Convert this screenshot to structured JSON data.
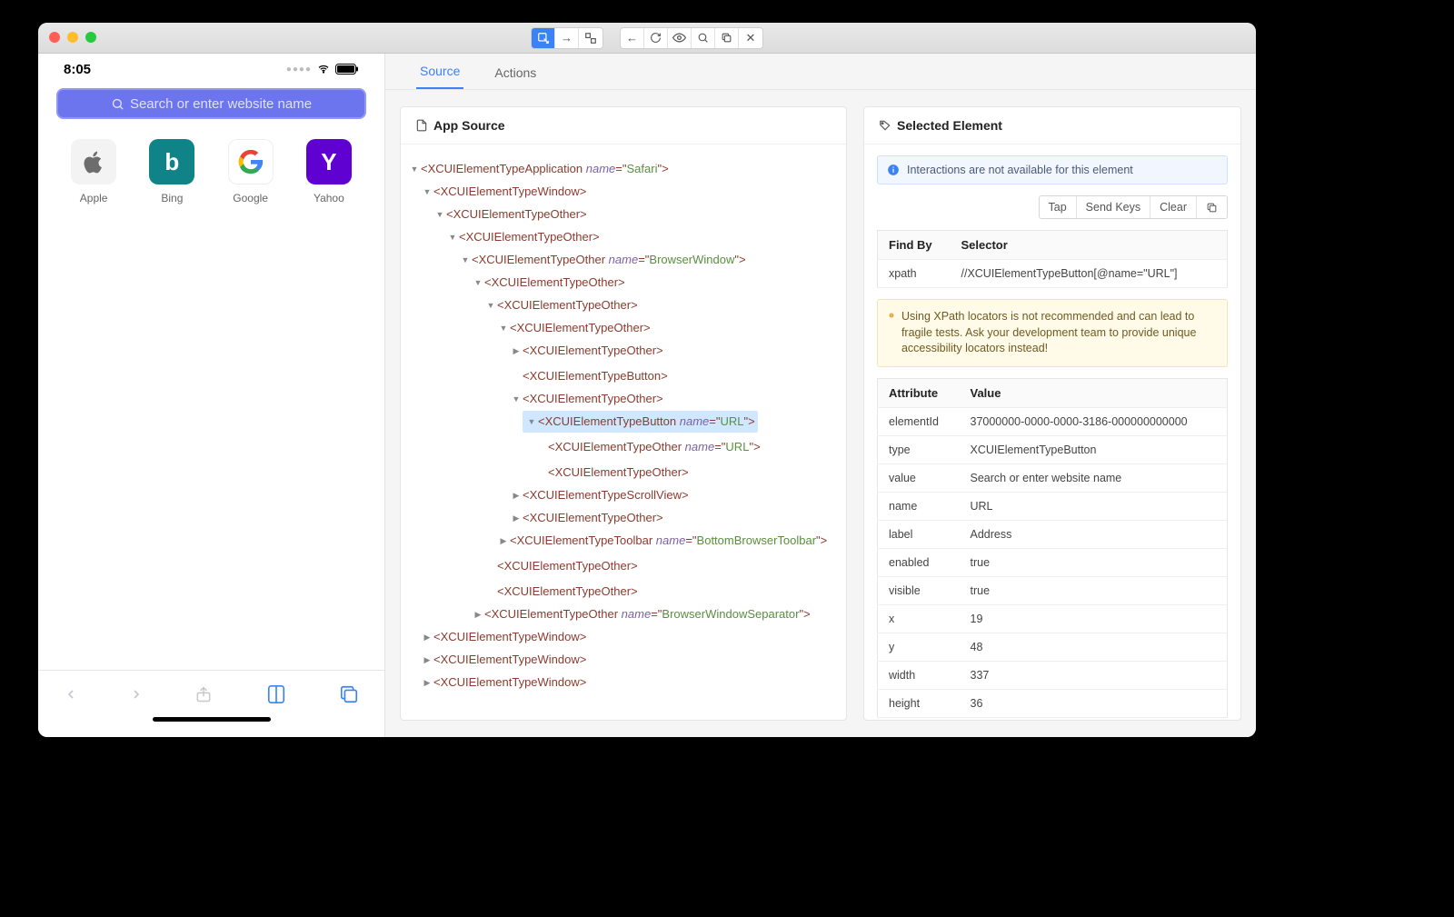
{
  "toolbar": {
    "group1": [
      "select",
      "swipe",
      "tap-coord"
    ],
    "group2": [
      "back",
      "refresh",
      "eye",
      "search",
      "copy",
      "close"
    ]
  },
  "tabs": {
    "source": "Source",
    "actions": "Actions"
  },
  "phone": {
    "time": "8:05",
    "search_placeholder": "Search or enter website name",
    "favorites": [
      {
        "label": "Apple"
      },
      {
        "label": "Bing"
      },
      {
        "label": "Google"
      },
      {
        "label": "Yahoo"
      }
    ]
  },
  "app_source": {
    "title": "App Source"
  },
  "tree": {
    "tag": "XCUIElementTypeApplication",
    "attrs": {
      "name": "Safari"
    },
    "open": true,
    "children": [
      {
        "tag": "XCUIElementTypeWindow",
        "open": true,
        "children": [
          {
            "tag": "XCUIElementTypeOther",
            "open": true,
            "children": [
              {
                "tag": "XCUIElementTypeOther",
                "open": true,
                "children": [
                  {
                    "tag": "XCUIElementTypeOther",
                    "attrs": {
                      "name": "BrowserWindow"
                    },
                    "open": true,
                    "children": [
                      {
                        "tag": "XCUIElementTypeOther",
                        "open": true,
                        "children": [
                          {
                            "tag": "XCUIElementTypeOther",
                            "open": true,
                            "children": [
                              {
                                "tag": "XCUIElementTypeOther",
                                "open": true,
                                "children": [
                                  {
                                    "tag": "XCUIElementTypeOther",
                                    "collapsed": true
                                  },
                                  {
                                    "tag": "XCUIElementTypeButton",
                                    "leaf": true
                                  },
                                  {
                                    "tag": "XCUIElementTypeOther",
                                    "open": true,
                                    "children": [
                                      {
                                        "tag": "XCUIElementTypeButton",
                                        "attrs": {
                                          "name": "URL"
                                        },
                                        "open": true,
                                        "selected": true,
                                        "children": [
                                          {
                                            "tag": "XCUIElementTypeOther",
                                            "attrs": {
                                              "name": "URL"
                                            },
                                            "leaf": true
                                          },
                                          {
                                            "tag": "XCUIElementTypeOther",
                                            "leaf": true
                                          }
                                        ]
                                      }
                                    ]
                                  },
                                  {
                                    "tag": "XCUIElementTypeScrollView",
                                    "collapsed": true
                                  },
                                  {
                                    "tag": "XCUIElementTypeOther",
                                    "collapsed": true
                                  }
                                ]
                              },
                              {
                                "tag": "XCUIElementTypeToolbar",
                                "attrs": {
                                  "name": "BottomBrowserToolbar"
                                },
                                "collapsed": true
                              }
                            ]
                          },
                          {
                            "tag": "XCUIElementTypeOther",
                            "leaf": true
                          },
                          {
                            "tag": "XCUIElementTypeOther",
                            "leaf": true
                          }
                        ]
                      },
                      {
                        "tag": "XCUIElementTypeOther",
                        "attrs": {
                          "name": "BrowserWindowSeparator"
                        },
                        "collapsed": true
                      }
                    ]
                  }
                ]
              }
            ]
          }
        ]
      },
      {
        "tag": "XCUIElementTypeWindow",
        "collapsed": true
      },
      {
        "tag": "XCUIElementTypeWindow",
        "collapsed": true
      },
      {
        "tag": "XCUIElementTypeWindow",
        "collapsed": true
      }
    ]
  },
  "selected": {
    "title": "Selected Element",
    "info": "Interactions are not available for this element",
    "buttons": {
      "tap": "Tap",
      "sendkeys": "Send Keys",
      "clear": "Clear"
    },
    "findby_header": {
      "c1": "Find By",
      "c2": "Selector"
    },
    "findby": [
      {
        "by": "xpath",
        "sel": "//XCUIElementTypeButton[@name=\"URL\"]"
      }
    ],
    "warning": "Using XPath locators is not recommended and can lead to fragile tests. Ask your development team to provide unique accessibility locators instead!",
    "attr_header": {
      "c1": "Attribute",
      "c2": "Value"
    },
    "attributes": [
      {
        "k": "elementId",
        "v": "37000000-0000-0000-3186-000000000000"
      },
      {
        "k": "type",
        "v": "XCUIElementTypeButton"
      },
      {
        "k": "value",
        "v": "Search or enter website name"
      },
      {
        "k": "name",
        "v": "URL"
      },
      {
        "k": "label",
        "v": "Address"
      },
      {
        "k": "enabled",
        "v": "true"
      },
      {
        "k": "visible",
        "v": "true"
      },
      {
        "k": "x",
        "v": "19"
      },
      {
        "k": "y",
        "v": "48"
      },
      {
        "k": "width",
        "v": "337"
      },
      {
        "k": "height",
        "v": "36"
      }
    ]
  }
}
